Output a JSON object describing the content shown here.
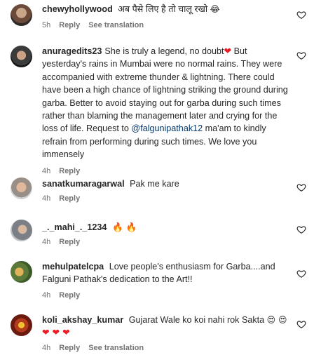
{
  "comments": [
    {
      "username": "chewyhollywood",
      "text": "अब पैसे लिए है तो चालू रखो",
      "emoji": "😂",
      "time": "5h",
      "reply_label": "Reply",
      "translation_label": "See translation"
    },
    {
      "username": "anuragedits23",
      "text_part1": "She is truly a legend, no doubt",
      "heart": "❤",
      "text_part2": " But yesterday's rains in Mumbai were no normal rains. They were accompanied with extreme thunder & lightning. There could have been a high chance of lightning striking the ground during garba. Better to avoid staying out for garba during such times rather than blaming the management later and crying for the loss of life. Request to ",
      "mention": "@falgunipathak12",
      "text_part3": " ma'am to kindly refrain from performing during such times. We love you immensely",
      "time": "4h",
      "reply_label": "Reply"
    },
    {
      "username": "sanatkumaragarwal",
      "text": "Pak me kare",
      "time": "4h",
      "reply_label": "Reply"
    },
    {
      "username": "_._mahi_._1234",
      "emoji": "🔥 🔥",
      "time": "4h",
      "reply_label": "Reply"
    },
    {
      "username": "mehulpatelcpa",
      "text": "Love people's enthusiasm for Garba....and Falguni Pathak's dedication to the Art!!",
      "time": "4h",
      "reply_label": "Reply"
    },
    {
      "username": "koli_akshay_kumar",
      "text": "Gujarat Wale ko koi nahi rok Sakta",
      "emoji_faces": "😍 😍",
      "hearts": "❤ ❤ ❤",
      "time": "4h",
      "reply_label": "Reply",
      "translation_label": "See translation"
    }
  ]
}
